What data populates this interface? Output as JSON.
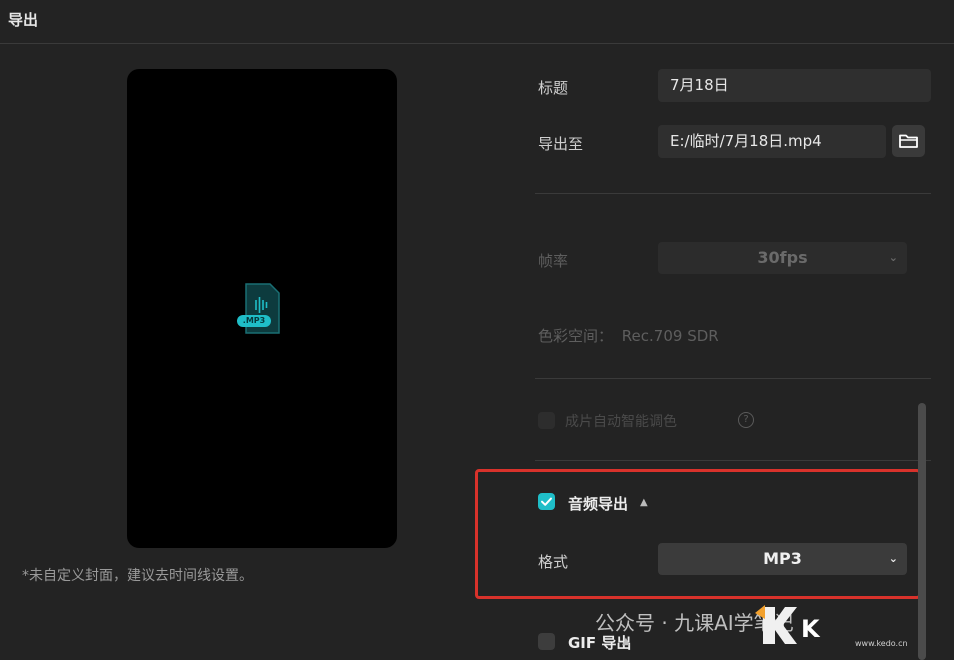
{
  "window": {
    "title": "导出"
  },
  "preview": {
    "file_badge": ".MP3",
    "note": "*未自定义封面，建议去时间线设置。"
  },
  "title_field": {
    "label": "标题",
    "value": "7月18日"
  },
  "export_to": {
    "label": "导出至",
    "value": "E:/临时/7月18日.mp4",
    "icon": "folder-icon"
  },
  "framerate": {
    "label": "帧率",
    "value": "30fps"
  },
  "color_space": {
    "label": "色彩空间：",
    "value": "Rec.709 SDR"
  },
  "auto_adjust": {
    "label": "成片自动智能调色",
    "checked": false,
    "icon": "help-icon"
  },
  "audio_export": {
    "label": "音频导出",
    "checked": true,
    "format_label": "格式",
    "format_value": "MP3"
  },
  "gif_export": {
    "label": "GIF 导出",
    "checked": false
  },
  "watermark": {
    "text": "公众号 · 九课AI学笔记",
    "brand": "K",
    "site": "www.kedo.cn"
  },
  "colors": {
    "accent": "#1fbec8",
    "highlight": "#d8322b",
    "background": "#232323"
  }
}
